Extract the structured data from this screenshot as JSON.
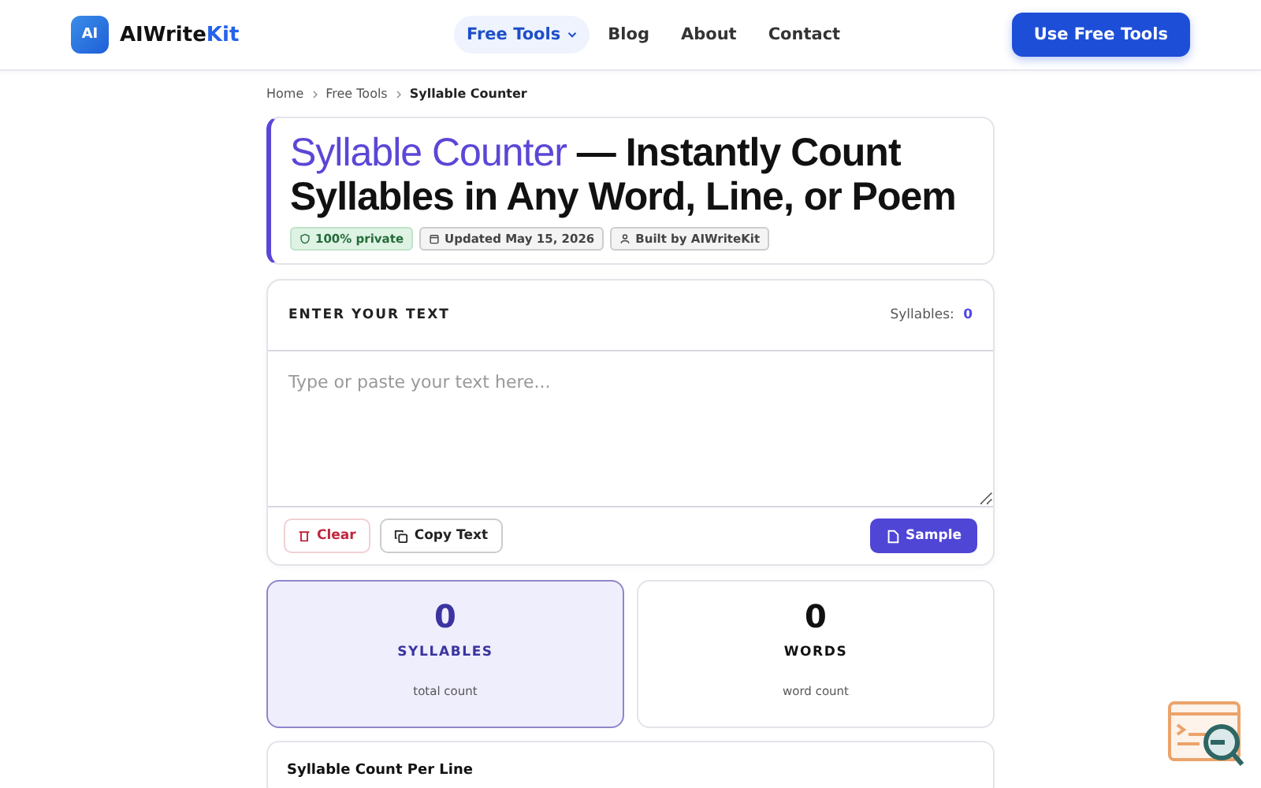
{
  "header": {
    "logo_mark": "AI",
    "brand": "AIWrite",
    "brand_accent": "Kit",
    "nav": [
      {
        "label": "Free Tools",
        "selected": true,
        "has_menu": true
      },
      {
        "label": "Blog",
        "selected": false,
        "has_menu": false
      },
      {
        "label": "About",
        "selected": false,
        "has_menu": false
      },
      {
        "label": "Contact",
        "selected": false,
        "has_menu": false
      }
    ],
    "cta": "Use Free Tools"
  },
  "breadcrumb": [
    {
      "label": "Home",
      "current": false
    },
    {
      "label": "Free Tools",
      "current": false
    },
    {
      "label": "Syllable Counter",
      "current": true
    }
  ],
  "hero": {
    "title_accent": "Syllable Counter",
    "title_rest": " — Instantly Count Syllables in Any Word, Line, or Poem",
    "badges": [
      {
        "kind": "privacy",
        "label": "100% private"
      },
      {
        "kind": "date",
        "label": "Updated May 15, 2026"
      },
      {
        "kind": "author",
        "label": "Built by AIWriteKit"
      }
    ]
  },
  "editor": {
    "heading": "ENTER YOUR TEXT",
    "counter_label": "Syllables:",
    "counter_value": "0",
    "placeholder": "Type or paste your text here...",
    "buttons": [
      {
        "kind": "clear",
        "label": "Clear"
      },
      {
        "kind": "copy",
        "label": "Copy Text"
      },
      {
        "kind": "sample",
        "label": "Sample"
      }
    ]
  },
  "stats": [
    {
      "value": "0",
      "label": "SYLLABLES",
      "caption": "total count",
      "selected": true
    },
    {
      "value": "0",
      "label": "WORDS",
      "caption": "word count",
      "selected": false
    }
  ],
  "per_line": {
    "title": "Syllable Count Per Line"
  }
}
